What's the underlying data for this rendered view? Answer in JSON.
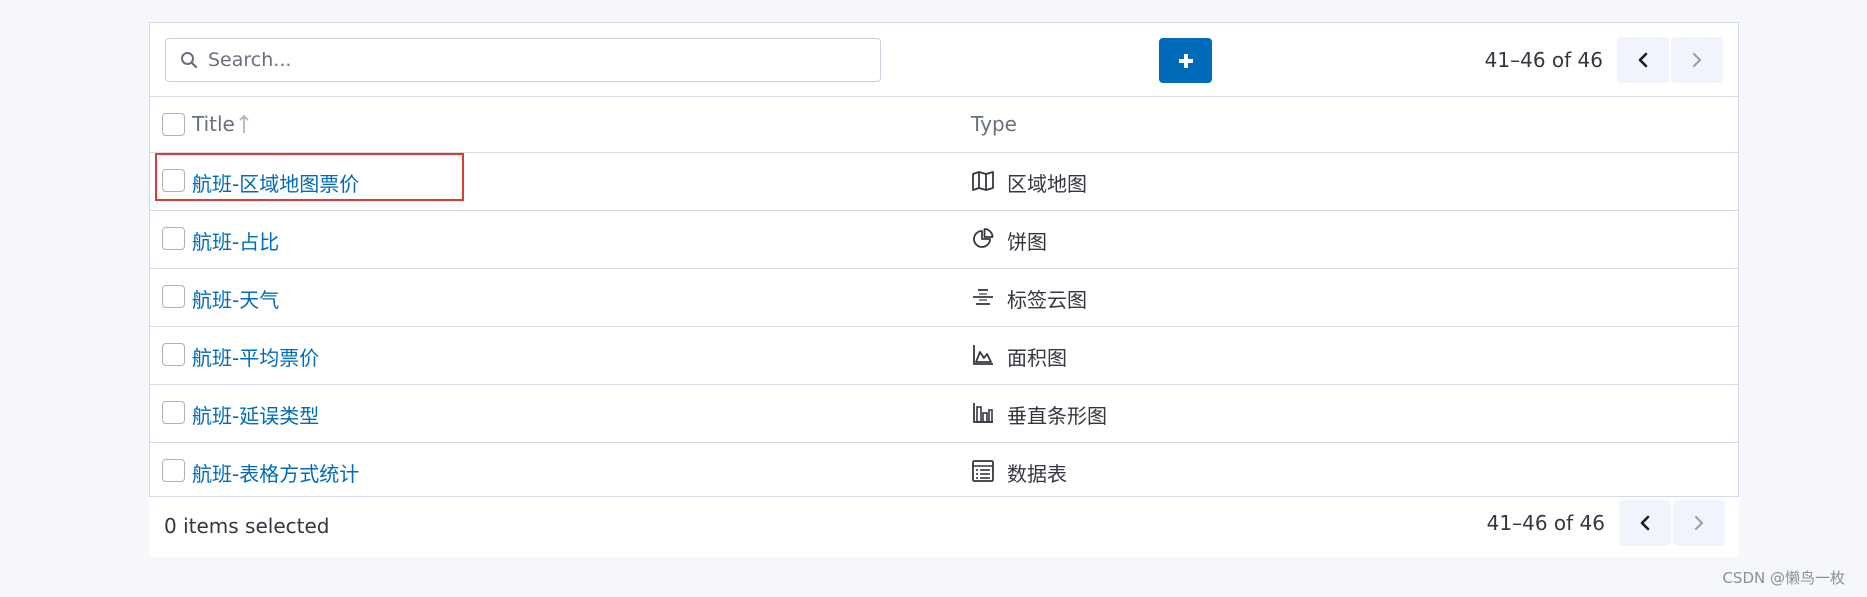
{
  "toolbar": {
    "search_placeholder": "Search...",
    "add_button_icon": "plus-icon",
    "range_text": "41–46 of 46"
  },
  "table": {
    "headers": {
      "title": "Title",
      "type": "Type"
    },
    "rows": [
      {
        "title": "航班-区域地图票价",
        "type": "区域地图",
        "icon": "map-icon"
      },
      {
        "title": "航班-占比",
        "type": "饼图",
        "icon": "pie-chart-icon"
      },
      {
        "title": "航班-天气",
        "type": "标签云图",
        "icon": "tag-cloud-icon"
      },
      {
        "title": "航班-平均票价",
        "type": "面积图",
        "icon": "area-chart-icon"
      },
      {
        "title": "航班-延误类型",
        "type": "垂直条形图",
        "icon": "bar-chart-icon"
      },
      {
        "title": "航班-表格方式统计",
        "type": "数据表",
        "icon": "table-icon"
      }
    ]
  },
  "footer": {
    "selected_text": "0 items selected",
    "range_text": "41–46 of 46"
  },
  "watermark": "CSDN @懒鸟一枚",
  "colors": {
    "accent": "#006bb8",
    "highlight_box": "#e53935",
    "border": "#d3dae6"
  }
}
